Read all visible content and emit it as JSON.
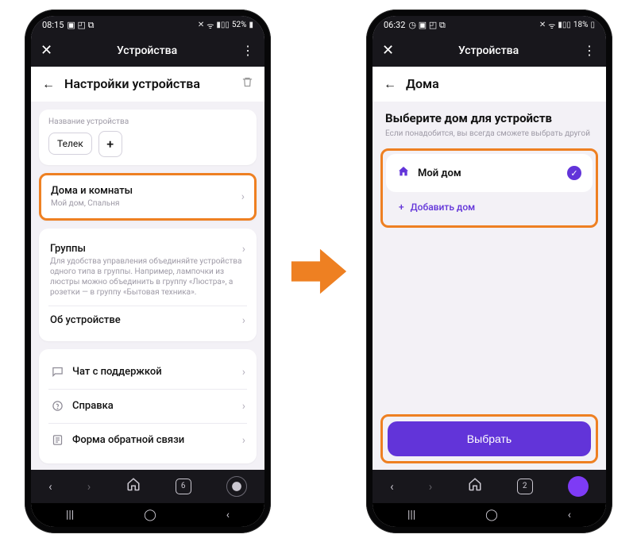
{
  "left_phone": {
    "status": {
      "time": "08:15",
      "battery": "52%"
    },
    "appbar": {
      "title": "Устройства"
    },
    "header": {
      "title": "Настройки устройства"
    },
    "device_label": "Название устройства",
    "device_chip": "Телек",
    "rooms": {
      "title": "Дома и комнаты",
      "subtitle": "Мой дом, Спальня"
    },
    "groups": {
      "title": "Группы",
      "subtitle": "Для удобства управления объединяйте устройства одного типа в группы. Например, лампочки из люстры можно объединить в группу «Люстра», а розетки — в группу «Бытовая техника»."
    },
    "about": "Об устройстве",
    "support": "Чат с поддержкой",
    "help": "Справка",
    "feedback": "Форма обратной связи",
    "tab_count": "6"
  },
  "right_phone": {
    "status": {
      "time": "06:32",
      "battery": "18%"
    },
    "appbar": {
      "title": "Устройства"
    },
    "header": {
      "title": "Дома"
    },
    "body_title": "Выберите дом для устройств",
    "body_sub": "Если понадобится, вы всегда сможете выбрать другой",
    "home_name": "Мой дом",
    "add_home": "Добавить дом",
    "button": "Выбрать",
    "tab_count": "2"
  }
}
